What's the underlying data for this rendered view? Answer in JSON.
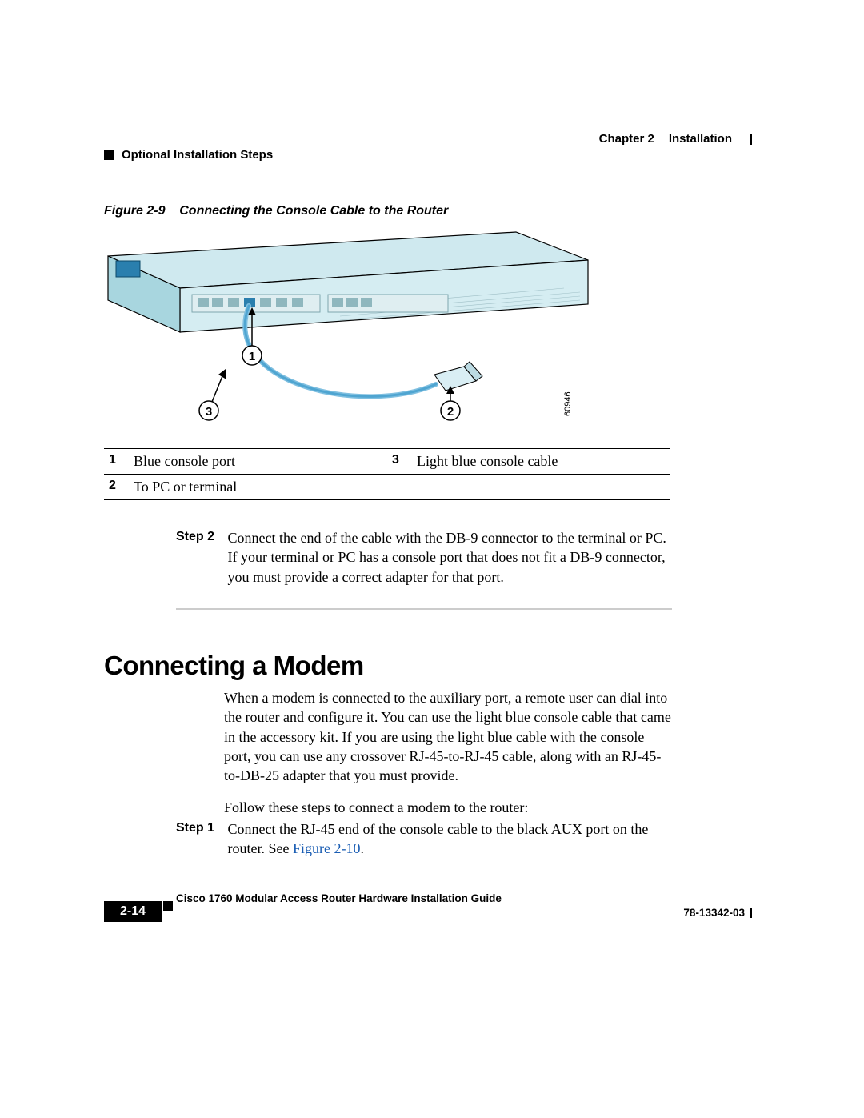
{
  "header": {
    "chapter_label": "Chapter 2",
    "chapter_title": "Installation",
    "section_title": "Optional Installation Steps"
  },
  "figure": {
    "caption_prefix": "Figure 2-9",
    "caption_text": "Connecting the Console Cable to the Router",
    "art_number": "60946",
    "callouts": [
      "1",
      "2",
      "3"
    ]
  },
  "legend": {
    "rows": [
      {
        "num": "1",
        "desc": "Blue console port"
      },
      {
        "num": "2",
        "desc": "To PC or terminal"
      },
      {
        "num": "3",
        "desc": "Light blue console cable"
      }
    ]
  },
  "step2": {
    "label": "Step 2",
    "text": "Connect the end of the cable with the DB-9 connector to the terminal or PC. If your terminal or PC has a console port that does not fit a DB-9 connector, you must provide a correct adapter for that port."
  },
  "section": {
    "heading": "Connecting a Modem",
    "para1": "When a modem is connected to the auxiliary port, a remote user can dial into the router and configure it. You can use the light blue console cable that came in the accessory kit. If you are using the light blue cable with the console port, you can use any crossover RJ-45-to-RJ-45 cable, along with an RJ-45-to-DB-25 adapter that you must provide.",
    "para2": "Follow these steps to connect a modem to the router:"
  },
  "step1b": {
    "label": "Step 1",
    "text_pre": "Connect the RJ-45 end of the console cable to the black AUX port on the router. See ",
    "xref": "Figure 2-10",
    "text_post": "."
  },
  "footer": {
    "book_title": "Cisco 1760 Modular Access Router Hardware Installation Guide",
    "page_number": "2-14",
    "doc_number": "78-13342-03"
  }
}
